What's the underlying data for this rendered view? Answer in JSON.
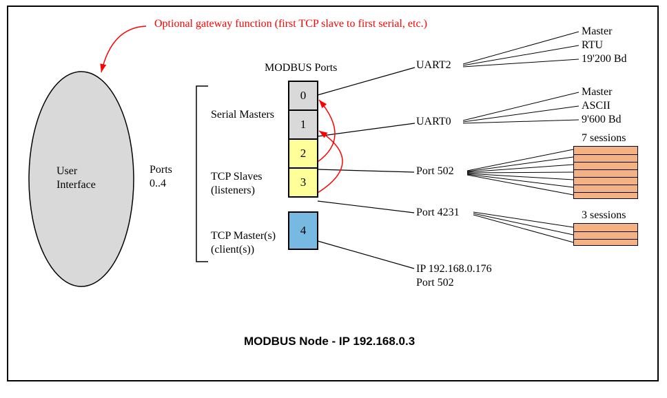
{
  "caption": "MODBUS Node - IP 192.168.0.3",
  "optional_note": "Optional gateway function (first TCP slave to first serial, etc.)",
  "oval_label_line1": "User",
  "oval_label_line2": "Interface",
  "ports_label_line1": "Ports",
  "ports_label_line2": "0..4",
  "col_header": "MODBUS Ports",
  "group_serial": "Serial Masters",
  "group_tcps_line1": "TCP Slaves",
  "group_tcps_line2": "(listeners)",
  "group_tcpm_line1": "TCP Master(s)",
  "group_tcpm_line2": "(client(s))",
  "ports": {
    "p0": "0",
    "p1": "1",
    "p2": "2",
    "p3": "3",
    "p4": "4"
  },
  "uart2": "UART2",
  "uart0": "UART0",
  "port502": "Port 502",
  "port4231": "Port 4231",
  "ip_line1": "IP 192.168.0.176",
  "ip_line2": "Port 502",
  "serial0": {
    "l1": "Master",
    "l2": "RTU",
    "l3": "19'200 Bd"
  },
  "serial1": {
    "l1": "Master",
    "l2": "ASCII",
    "l3": "9'600 Bd"
  },
  "sessions7": "7 sessions",
  "sessions3": "3 sessions"
}
